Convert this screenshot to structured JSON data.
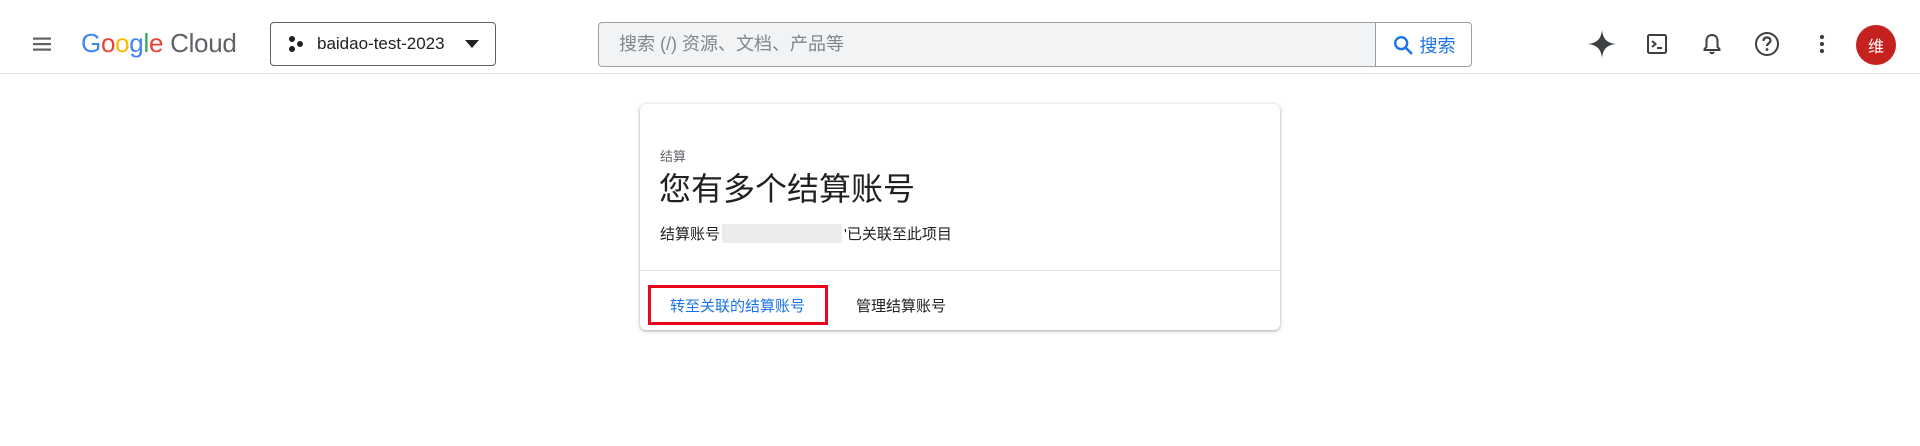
{
  "header": {
    "menu_icon": "hamburger-menu-icon",
    "logo": {
      "google_letters": [
        "G",
        "o",
        "o",
        "g",
        "l",
        "e"
      ],
      "product": "Cloud"
    },
    "project": {
      "name": "baidao-test-2023",
      "icon": "project-dots-icon",
      "caret_icon": "chevron-down-icon"
    },
    "search": {
      "placeholder": "搜索 (/) 资源、文档、产品等",
      "value": "",
      "button_label": "搜索",
      "icon": "search-icon"
    },
    "actions": [
      {
        "name": "gemini-sparkle-icon"
      },
      {
        "name": "cloud-shell-icon"
      },
      {
        "name": "notifications-bell-icon"
      },
      {
        "name": "help-icon"
      },
      {
        "name": "more-vert-icon"
      }
    ],
    "avatar_initial": "维"
  },
  "card": {
    "eyebrow": "结算",
    "title": "您有多个结算账号",
    "desc_prefix": "结算账号",
    "desc_suffix": "'已关联至此项目",
    "primary_action": "转至关联的结算账号",
    "secondary_action": "管理结算账号"
  },
  "colors": {
    "accent": "#1a73e8",
    "highlight": "#e8071a",
    "avatar_bg": "#c5221f"
  }
}
